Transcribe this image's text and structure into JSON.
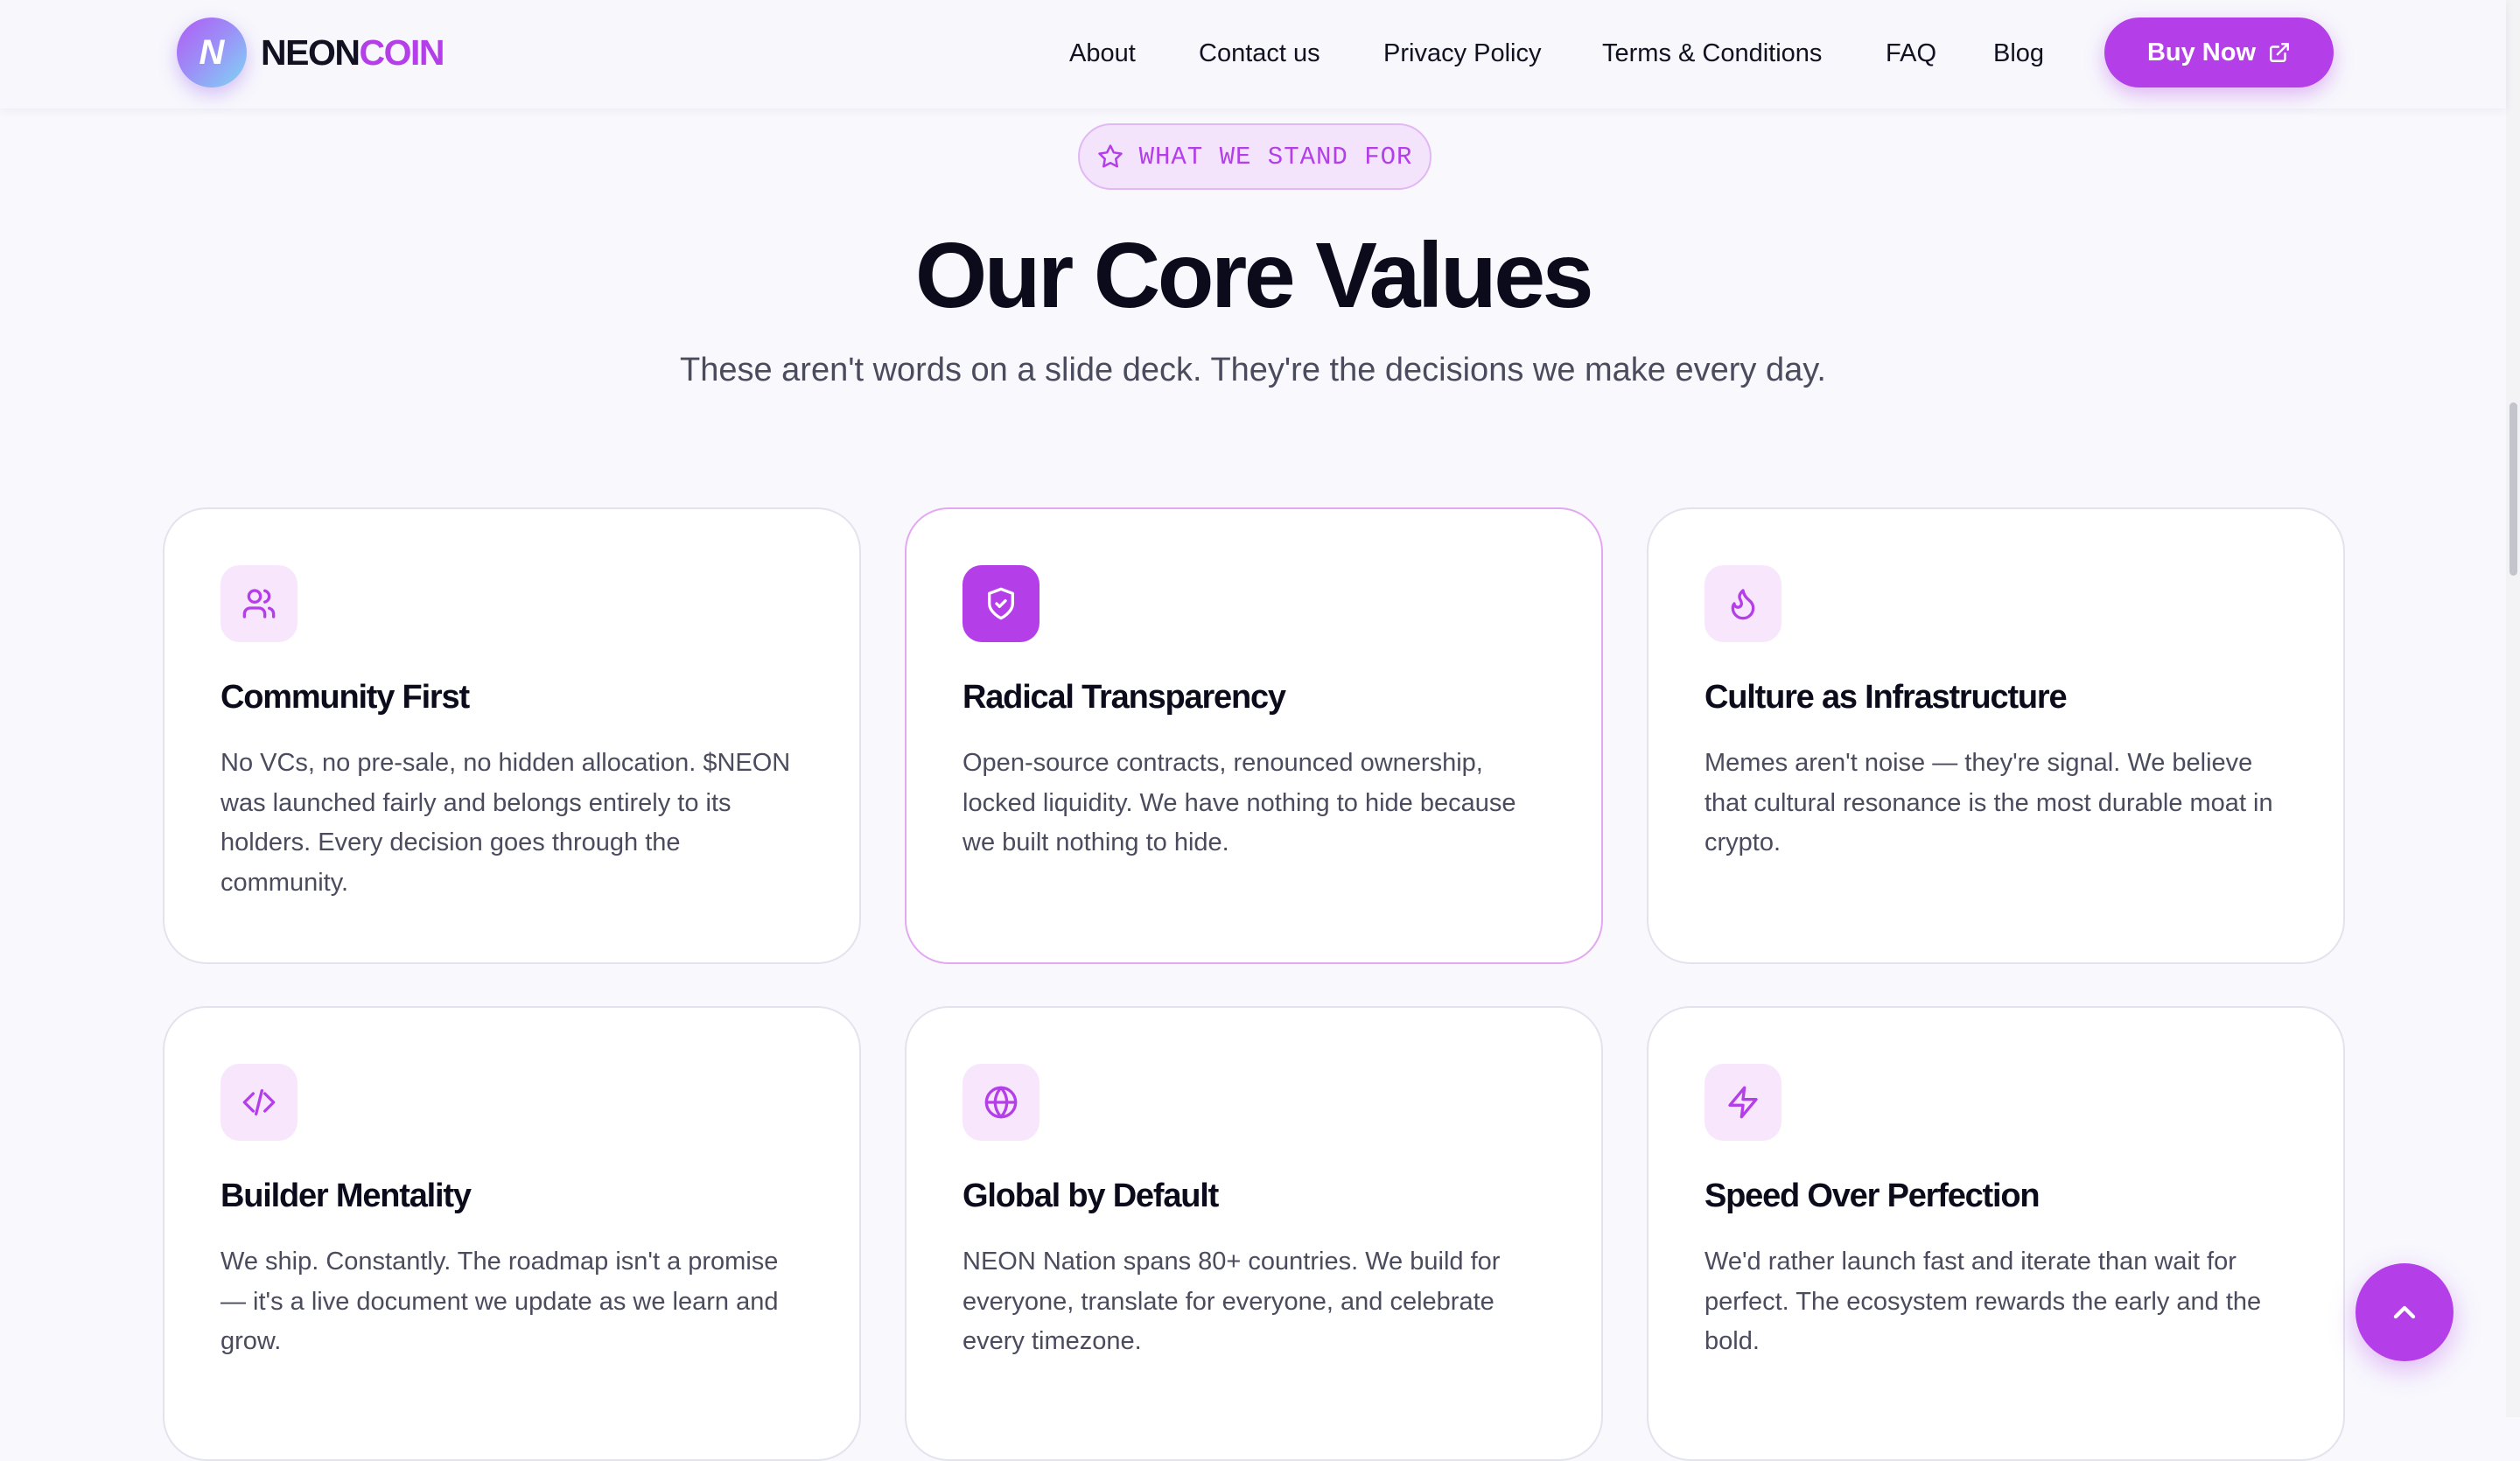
{
  "header": {
    "logo_letter": "N",
    "logo_word1": "NEON",
    "logo_word2": "COIN",
    "nav": [
      {
        "label": "About"
      },
      {
        "label": "Contact us"
      },
      {
        "label": "Privacy Policy"
      },
      {
        "label": "Terms & Conditions"
      },
      {
        "label": "FAQ"
      },
      {
        "label": "Blog"
      }
    ],
    "buy_label": "Buy Now",
    "buy_icon": "external-link-icon"
  },
  "hero": {
    "pill_icon": "star-icon",
    "pill_text": "WHAT WE STAND FOR",
    "title": "Our Core Values",
    "subtitle": "These aren't words on a slide deck. They're the decisions we make every day."
  },
  "cards": [
    {
      "icon": "users-icon",
      "title": "Community First",
      "desc": "No VCs, no pre-sale, no hidden allocation. $NEON was launched fairly and belongs entirely to its holders. Every decision goes through the community."
    },
    {
      "icon": "shield-check-icon",
      "title": "Radical Transparency",
      "desc": "Open-source contracts, renounced ownership, locked liquidity. We have nothing to hide because we built nothing to hide."
    },
    {
      "icon": "flame-icon",
      "title": "Culture as Infrastructure",
      "desc": "Memes aren't noise — they're signal. We believe that cultural resonance is the most durable moat in crypto."
    },
    {
      "icon": "code-icon",
      "title": "Builder Mentality",
      "desc": "We ship. Constantly. The roadmap isn't a promise — it's a live document we update as we learn and grow."
    },
    {
      "icon": "globe-icon",
      "title": "Global by Default",
      "desc": "NEON Nation spans 80+ countries. We build for everyone, translate for everyone, and celebrate every timezone."
    },
    {
      "icon": "zap-icon",
      "title": "Speed Over Perfection",
      "desc": "We'd rather launch fast and iterate than wait for perfect. The ecosystem rewards the early and the bold."
    }
  ],
  "colors": {
    "accent": "#b43fe8",
    "accent_light": "#f7e6fc",
    "background": "#f8f8fd",
    "heading": "#0b0b1c",
    "body_text": "#4b4b5e"
  },
  "back_to_top_icon": "chevron-up-icon"
}
